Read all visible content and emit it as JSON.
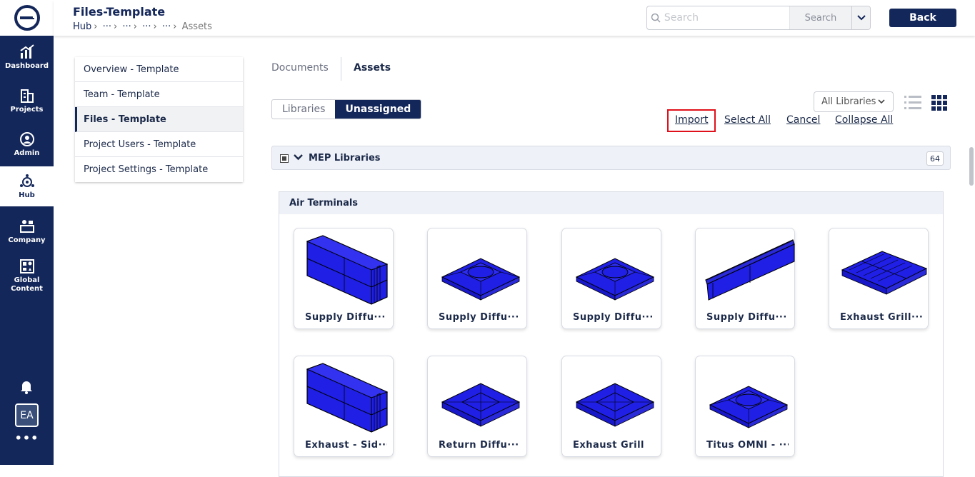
{
  "rail": {
    "items": [
      {
        "label": "Dashboard",
        "icon": "dashboard-icon"
      },
      {
        "label": "Projects",
        "icon": "projects-icon"
      },
      {
        "label": "Admin",
        "icon": "admin-icon"
      },
      {
        "label": "Hub",
        "icon": "hub-icon",
        "active": true
      },
      {
        "label": "Company",
        "icon": "company-icon"
      },
      {
        "label": "Global\nContent",
        "icon": "global-content-icon"
      }
    ],
    "avatar": "EA",
    "more": "•••"
  },
  "header": {
    "title": "Files-Template",
    "breadcrumb": [
      "Hub",
      "···",
      "···",
      "···",
      "···",
      "Assets"
    ],
    "search_placeholder": "Search",
    "search_button": "Search",
    "back_button": "Back"
  },
  "sidemenu": {
    "items": [
      {
        "label": "Overview - Template"
      },
      {
        "label": "Team - Template"
      },
      {
        "label": "Files - Template",
        "active": true
      },
      {
        "label": "Project Users - Template"
      },
      {
        "label": "Project Settings - Template"
      }
    ]
  },
  "tabs": {
    "documents": "Documents",
    "assets": "Assets"
  },
  "toggle": {
    "libraries": "Libraries",
    "unassigned": "Unassigned"
  },
  "library_filter": "All Libraries",
  "actions": {
    "import": "Import",
    "select_all": "Select All",
    "cancel": "Cancel",
    "collapse_all": "Collapse All"
  },
  "library": {
    "name": "MEP Libraries",
    "count": "64"
  },
  "category": {
    "name": "Air Terminals",
    "items": [
      {
        "label": "Supply Diffu···",
        "shape": "box-long"
      },
      {
        "label": "Supply Diffu···",
        "shape": "square-round"
      },
      {
        "label": "Supply Diffu···",
        "shape": "square-round"
      },
      {
        "label": "Supply Diffu···",
        "shape": "linear-slot"
      },
      {
        "label": "Exhaust Grill···",
        "shape": "grille"
      },
      {
        "label": "Exhaust - Sid···",
        "shape": "box-long"
      },
      {
        "label": "Return Diffu···",
        "shape": "square-panel"
      },
      {
        "label": "Exhaust Grill",
        "shape": "square-panel"
      },
      {
        "label": "Titus OMNI - ···",
        "shape": "square-round"
      }
    ]
  },
  "colors": {
    "navy": "#14275a",
    "model_blue": "#1f1fe6",
    "highlight_red": "#e0101a"
  }
}
